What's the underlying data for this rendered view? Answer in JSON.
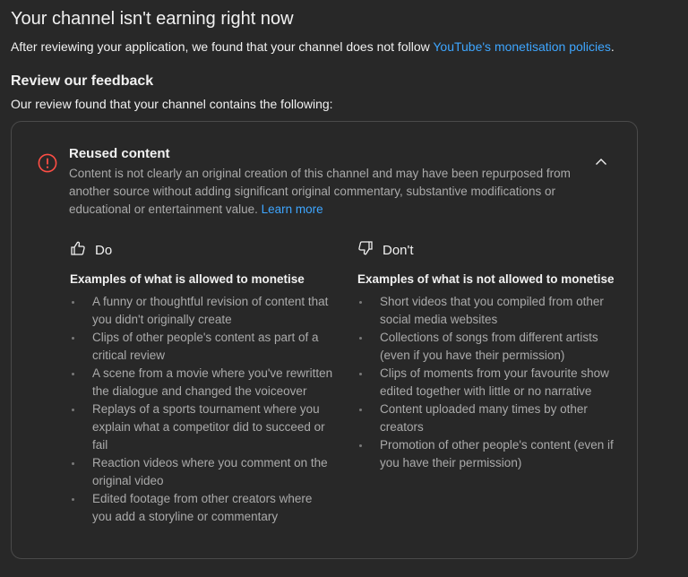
{
  "header": {
    "title": "Your channel isn't earning right now",
    "intro_text": "After reviewing your application, we found that your channel does not follow ",
    "intro_link": "YouTube's monetisation policies",
    "intro_end": "."
  },
  "review": {
    "heading": "Review our feedback",
    "subheading": "Our review found that your channel contains the following:"
  },
  "issue": {
    "icon": "alert-circle-icon",
    "title": "Reused content",
    "description": "Content is not clearly an original creation of this channel and may have been repurposed from another source without adding significant original commentary, substantive modifications or educational or entertainment value. ",
    "learn_more": "Learn more",
    "expanded": true
  },
  "do": {
    "icon": "thumbs-up-icon",
    "label": "Do",
    "examples_title": "Examples of what is allowed to monetise",
    "items": [
      "A funny or thoughtful revision of content that you didn't originally create",
      "Clips of other people's content as part of a critical review",
      "A scene from a movie where you've rewritten the dialogue and changed the voiceover",
      "Replays of a sports tournament where you explain what a competitor did to succeed or fail",
      "Reaction videos where you comment on the original video",
      "Edited footage from other creators where you add a storyline or commentary"
    ]
  },
  "dont": {
    "icon": "thumbs-down-icon",
    "label": "Don't",
    "examples_title": "Examples of what is not allowed to monetise",
    "items": [
      "Short videos that you compiled from other social media websites",
      "Collections of songs from different artists (even if you have their permission)",
      "Clips of moments from your favourite show edited together with little or no narrative",
      "Content uploaded many times by other creators",
      "Promotion of other people's content (even if you have their permission)"
    ]
  },
  "colors": {
    "background": "#282828",
    "link": "#3ea6ff",
    "alert": "#ff4e45",
    "secondary_text": "#aaaaaa"
  }
}
